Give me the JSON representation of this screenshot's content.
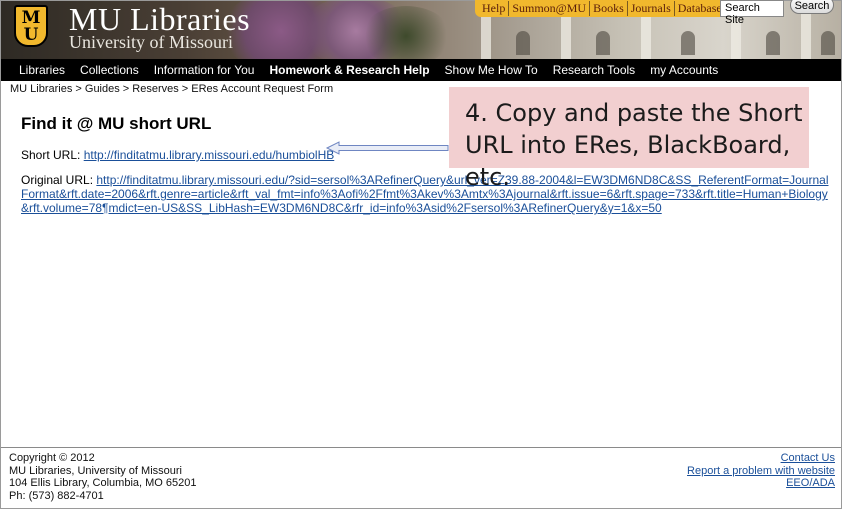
{
  "header": {
    "logo_m": "M",
    "logo_u": "U",
    "title": "MU Libraries",
    "subtitle": "University of Missouri",
    "top_links": [
      "Help",
      "Summon@MU",
      "Books",
      "Journals",
      "Databases"
    ],
    "search_placeholder": "Search Site",
    "search_button": "Search",
    "colors": {
      "gold": "#f1b82d",
      "black": "#000000"
    }
  },
  "nav": {
    "items": [
      "Libraries",
      "Collections",
      "Information for You",
      "Homework & Research Help",
      "Show Me How To",
      "Research Tools",
      "my Accounts"
    ],
    "active": "Homework & Research Help"
  },
  "breadcrumb": "MU Libraries > Guides > Reserves > ERes Account Request Form",
  "main": {
    "title": "Find it @ MU short URL",
    "short_url_label": "Short URL:",
    "short_url": "http://finditatmu.library.missouri.edu/humbiolHB",
    "original_url_label": "Original URL:",
    "original_url": "http://finditatmu.library.missouri.edu/?sid=sersol%3ARefinerQuery&url_ver=Z39.88-2004&l=EW3DM6ND8C&SS_ReferentFormat=JournalFormat&rft.date=2006&rft.genre=article&rft_val_fmt=info%3Aofi%2Ffmt%3Akev%3Amtx%3Ajournal&rft.issue=6&rft.spage=733&rft.title=Human+Biology&rft.volume=78¶mdict=en-US&SS_LibHash=EW3DM6ND8C&rfr_id=info%3Asid%2Fsersol%3ARefinerQuery&y=1&x=50"
  },
  "callout": {
    "text": "4. Copy and paste the Short URL into ERes, BlackBoard, etc.",
    "color": "#f2cfd0"
  },
  "footer": {
    "copyright": "Copyright © 2012",
    "org": "MU Libraries, University of Missouri",
    "address": "104 Ellis Library, Columbia, MO 65201",
    "phone": "Ph: (573) 882-4701",
    "contact": "Contact Us",
    "report": "Report a problem with website",
    "eeo": "EEO/ADA"
  }
}
